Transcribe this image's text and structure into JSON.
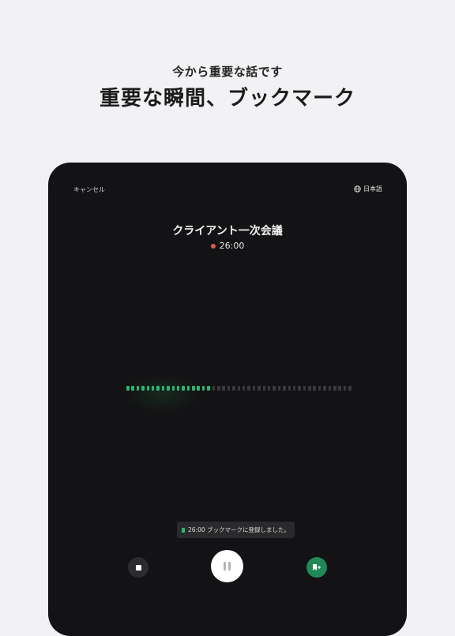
{
  "promo": {
    "subtitle": "今から重要な話です",
    "title": "重要な瞬間、ブックマーク"
  },
  "recorder": {
    "cancel_label": "キャンセル",
    "language_label": "日本語",
    "language_icon": "globe-icon",
    "title": "クライアント一次会議",
    "elapsed": "26:00",
    "waveform": {
      "total_bars": 45,
      "active_bars": 17,
      "active_color": "#2bb573",
      "inactive_color": "#3a3a3c"
    },
    "toast": {
      "text": "26:00 ブックマークに登録しました。",
      "icon": "bookmark-icon"
    },
    "controls": {
      "stop_icon": "stop-icon",
      "pause_icon": "pause-icon",
      "bookmark_add_icon": "bookmark-add-icon"
    }
  },
  "colors": {
    "accent": "#2bb573",
    "record_dot": "#e0584f",
    "panel_background": "#131214",
    "page_background": "#f2f1f4"
  }
}
